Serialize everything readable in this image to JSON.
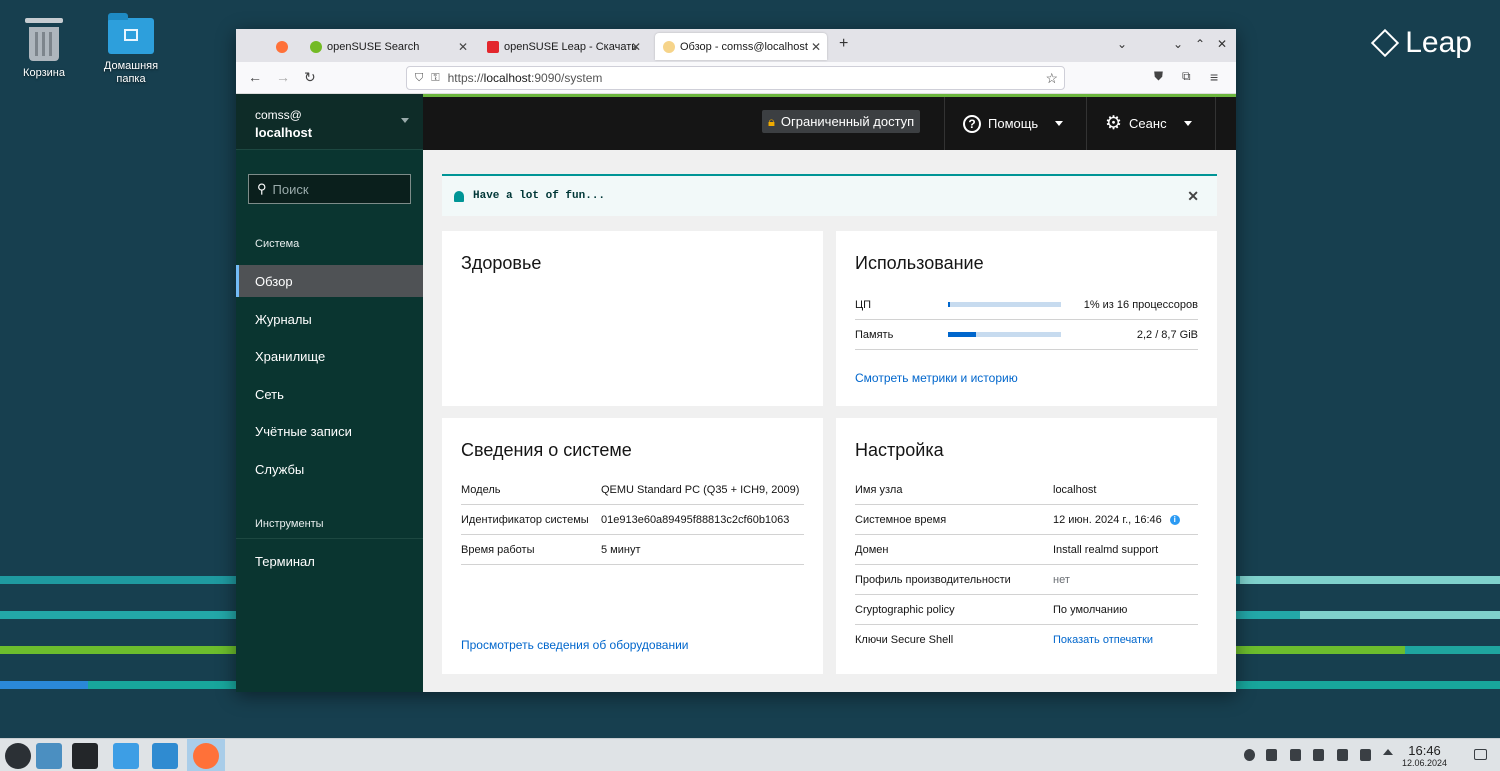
{
  "desktop": {
    "icons": [
      {
        "label": "Корзина"
      },
      {
        "label": "Домашняя папка"
      }
    ],
    "logo_text": "Leap"
  },
  "browser": {
    "tabs": [
      {
        "label": "openSUSE Search"
      },
      {
        "label": "openSUSE Leap - Скачать"
      },
      {
        "label": "Обзор - comss@localhost"
      }
    ],
    "new_tab": "+",
    "url_scheme": "https://",
    "url_host": "localhost",
    "url_rest": ":9090/system"
  },
  "cockpit": {
    "host": {
      "user": "comss@",
      "name": "localhost"
    },
    "search_placeholder": "Поиск",
    "sections": {
      "system": "Система",
      "tools": "Инструменты"
    },
    "nav_system": [
      "Обзор",
      "Журналы",
      "Хранилище",
      "Сеть",
      "Учётные записи",
      "Службы"
    ],
    "nav_tools": [
      "Терминал"
    ],
    "topbar": {
      "restricted": "Ограниченный доступ",
      "help": "Помощь",
      "session": "Сеанс"
    },
    "alert": "Have a lot of fun...",
    "health": {
      "title": "Здоровье"
    },
    "usage": {
      "title": "Использование",
      "cpu_label": "ЦП",
      "cpu_value": "1% из 16 процессоров",
      "cpu_fraction": 0.01,
      "mem_label": "Память",
      "mem_value": "2,2 / 8,7 GiB",
      "mem_fraction": 0.25,
      "link": "Смотреть метрики и историю"
    },
    "sysinfo": {
      "title": "Сведения о системе",
      "rows": [
        {
          "k": "Модель",
          "v": "QEMU Standard PC (Q35 + ICH9, 2009)"
        },
        {
          "k": "Идентификатор системы",
          "v": "01e913e60a89495f88813c2cf60b1063"
        },
        {
          "k": "Время работы",
          "v": "5 минут"
        }
      ],
      "link": "Просмотреть сведения об оборудовании"
    },
    "config": {
      "title": "Настройка",
      "rows": [
        {
          "k": "Имя узла",
          "v": "localhost"
        },
        {
          "k": "Системное время",
          "v": "12 июн. 2024 г., 16:46"
        },
        {
          "k": "Домен",
          "v": "Install realmd support"
        },
        {
          "k": "Профиль производительности",
          "v": "нет"
        },
        {
          "k": "Cryptographic policy",
          "v": "По умолчанию"
        },
        {
          "k": "Ключи Secure Shell",
          "v": "Показать отпечатки"
        }
      ]
    }
  },
  "taskbar": {
    "time": "16:46",
    "date": "12.06.2024"
  },
  "colors": {
    "accent": "#0066cc",
    "sidebar": "#0a3530",
    "topbar": "#151515",
    "alert_border": "#009596"
  }
}
